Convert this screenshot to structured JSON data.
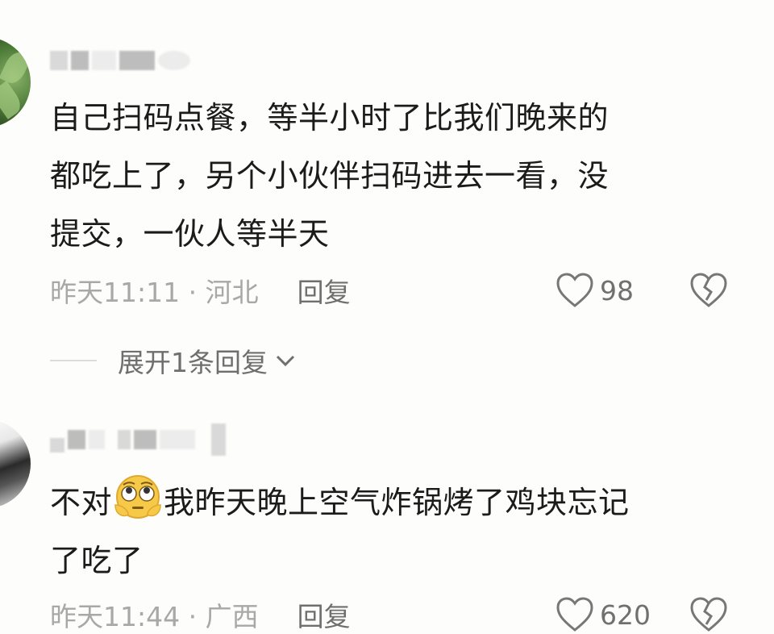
{
  "comments": [
    {
      "text_lines": [
        "自己扫码点餐，等半小时了比我们晚来的",
        "都吃上了，另个小伙伴扫码进去一看，没",
        "提交，一伙人等半天"
      ],
      "time": "昨天11:11 · 河北",
      "reply_label": "回复",
      "likes": "98",
      "expand_label": "展开1条回复"
    },
    {
      "text_before_emoji": "不对",
      "emoji": "flushed-face-emoji",
      "text_after_emoji": "我昨天晚上空气炸锅烤了鸡块忘记",
      "text_line2": "了吃了",
      "time": "昨天11:44 · 广西",
      "reply_label": "回复",
      "likes": "620"
    }
  ],
  "colors": {
    "background": "#fdfdfb",
    "text": "#1b1b1b",
    "meta": "#a3a3a3",
    "action": "#6f6f6f"
  }
}
